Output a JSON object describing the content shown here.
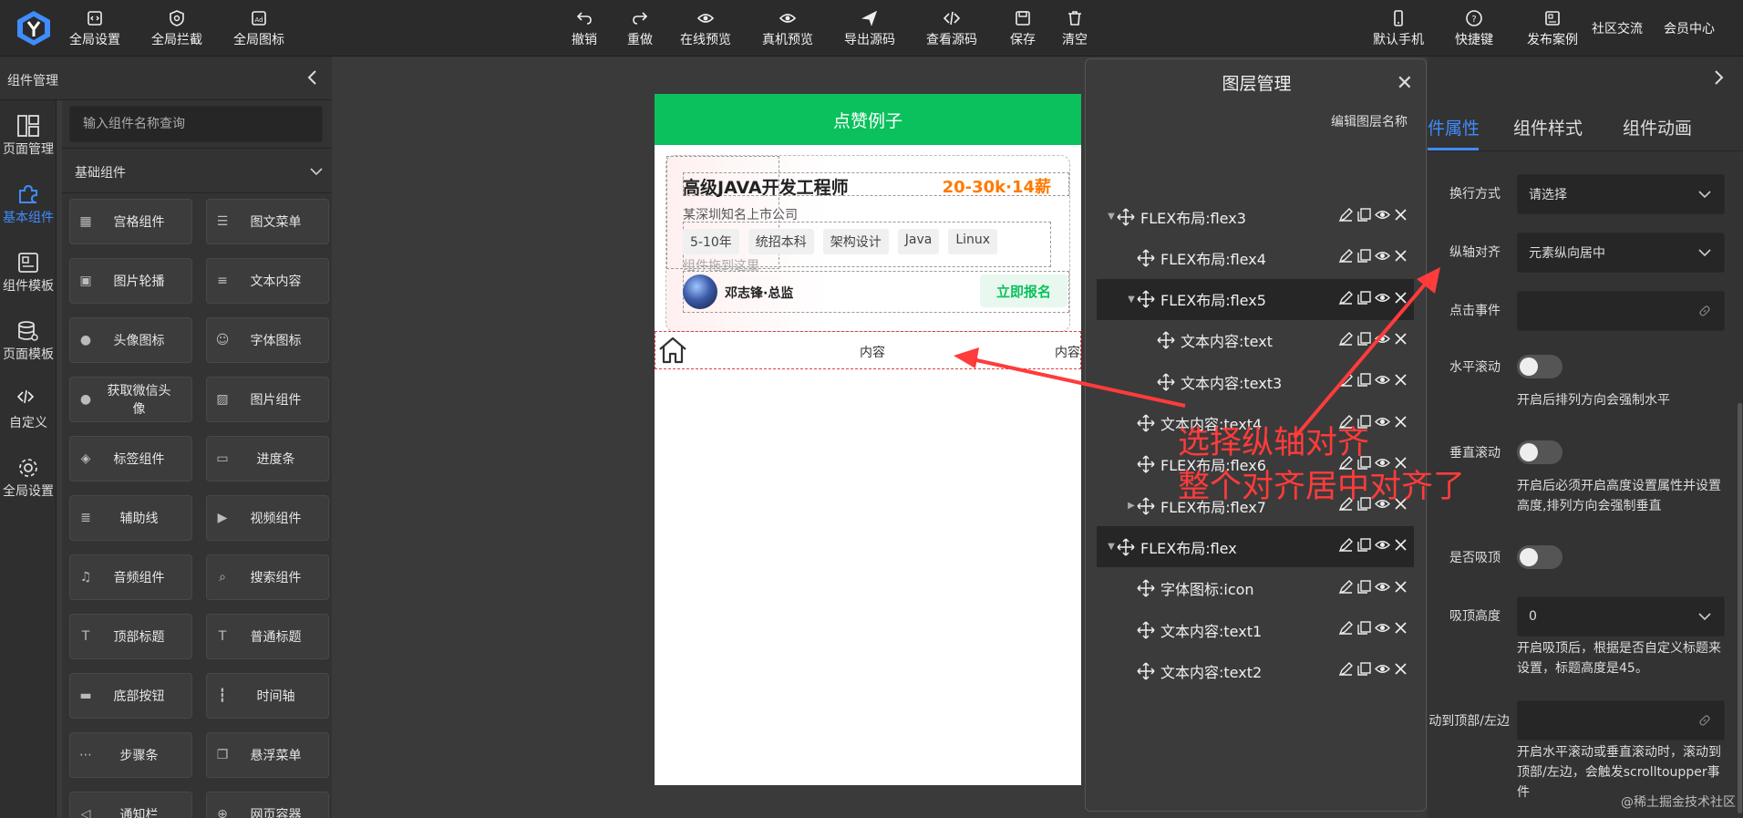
{
  "toolbar": {
    "left": [
      {
        "label": "全局设置",
        "icon": "code-file-icon"
      },
      {
        "label": "全局拦截",
        "icon": "shield-icon"
      },
      {
        "label": "全局图标",
        "icon": "image-icon"
      }
    ],
    "center": [
      {
        "label": "撤销",
        "icon": "undo-icon"
      },
      {
        "label": "重做",
        "icon": "redo-icon"
      },
      {
        "label": "在线预览",
        "icon": "eye-icon"
      },
      {
        "label": "真机预览",
        "icon": "eye-icon"
      },
      {
        "label": "导出源码",
        "icon": "send-icon"
      },
      {
        "label": "查看源码",
        "icon": "code-icon"
      },
      {
        "label": "保存",
        "icon": "save-icon"
      },
      {
        "label": "清空",
        "icon": "trash-icon"
      }
    ],
    "right": [
      {
        "label": "默认手机",
        "icon": "phone-icon"
      },
      {
        "label": "快捷键",
        "icon": "help-icon"
      },
      {
        "label": "发布案例",
        "icon": "gallery-icon"
      },
      {
        "label": "社区交流"
      },
      {
        "label": "会员中心"
      }
    ]
  },
  "rail": {
    "header": "组件管理",
    "items": [
      {
        "label": "页面管理",
        "icon": "layout-icon",
        "active": false
      },
      {
        "label": "基本组件",
        "icon": "puzzle-icon",
        "active": true
      },
      {
        "label": "组件模板",
        "icon": "template-icon",
        "active": false
      },
      {
        "label": "页面模板",
        "icon": "database-icon",
        "active": false
      },
      {
        "label": "自定义",
        "icon": "code-icon",
        "active": false
      },
      {
        "label": "全局设置",
        "icon": "gear-icon",
        "active": false
      }
    ]
  },
  "panel": {
    "search_placeholder": "输入组件名称查询",
    "category": "基础组件",
    "components": [
      {
        "label": "宫格组件",
        "icon": "grid-icon"
      },
      {
        "label": "图文菜单",
        "icon": "list-icon"
      },
      {
        "label": "图片轮播",
        "icon": "carousel-icon"
      },
      {
        "label": "文本内容",
        "icon": "text-icon"
      },
      {
        "label": "头像图标",
        "icon": "avatar-icon"
      },
      {
        "label": "字体图标",
        "icon": "smile-icon"
      },
      {
        "label": "获取微信头像",
        "icon": "avatar-icon"
      },
      {
        "label": "图片组件",
        "icon": "picture-icon"
      },
      {
        "label": "标签组件",
        "icon": "tag-icon"
      },
      {
        "label": "进度条",
        "icon": "progress-icon"
      },
      {
        "label": "辅助线",
        "icon": "lines-icon"
      },
      {
        "label": "视频组件",
        "icon": "video-icon"
      },
      {
        "label": "音频组件",
        "icon": "music-icon"
      },
      {
        "label": "搜索组件",
        "icon": "search-icon"
      },
      {
        "label": "顶部标题",
        "icon": "title-icon"
      },
      {
        "label": "普通标题",
        "icon": "title-icon"
      },
      {
        "label": "底部按钮",
        "icon": "bottom-button-icon"
      },
      {
        "label": "时间轴",
        "icon": "timeline-icon"
      },
      {
        "label": "步骤条",
        "icon": "steps-icon"
      },
      {
        "label": "悬浮菜单",
        "icon": "float-menu-icon"
      },
      {
        "label": "通知栏",
        "icon": "speaker-icon"
      },
      {
        "label": "网页容器",
        "icon": "globe-icon"
      }
    ]
  },
  "phone": {
    "header": "点赞例子",
    "job_title": "高级JAVA开发工程师",
    "salary": "20-30k·14薪",
    "company": "某深圳知名上市公司",
    "tags": [
      "5-10年",
      "统招本科",
      "架构设计",
      "Java",
      "Linux"
    ],
    "drag_hint": "组件拖到这里",
    "author": "邓志锋·总监",
    "apply": "立即报名",
    "bottom_label_1": "内容",
    "bottom_label_2": "内容"
  },
  "layers": {
    "title": "图层管理",
    "edit_label": "编辑图层名称",
    "rows": [
      {
        "label": "FLEX布局:flex3",
        "indent": 0,
        "arrow": "down",
        "selected": false
      },
      {
        "label": "FLEX布局:flex4",
        "indent": 1,
        "arrow": "",
        "selected": false
      },
      {
        "label": "FLEX布局:flex5",
        "indent": 1,
        "arrow": "down",
        "selected": true
      },
      {
        "label": "文本内容:text",
        "indent": 2,
        "arrow": "",
        "selected": false
      },
      {
        "label": "文本内容:text3",
        "indent": 2,
        "arrow": "",
        "selected": false
      },
      {
        "label": "文本内容:text4",
        "indent": 1,
        "arrow": "",
        "selected": false
      },
      {
        "label": "FLEX布局:flex6",
        "indent": 1,
        "arrow": "",
        "selected": false
      },
      {
        "label": "FLEX布局:flex7",
        "indent": 1,
        "arrow": "right",
        "selected": false
      },
      {
        "label": "FLEX布局:flex",
        "indent": 0,
        "arrow": "down",
        "selected": true
      },
      {
        "label": "字体图标:icon",
        "indent": 1,
        "arrow": "",
        "selected": false
      },
      {
        "label": "文本内容:text1",
        "indent": 1,
        "arrow": "",
        "selected": false
      },
      {
        "label": "文本内容:text2",
        "indent": 1,
        "arrow": "",
        "selected": false
      }
    ]
  },
  "props": {
    "tabs": [
      "件属性",
      "组件样式",
      "组件动画"
    ],
    "wrap_label": "换行方式",
    "wrap_value": "请选择",
    "cross_align_label": "纵轴对齐",
    "cross_align_value": "元素纵向居中",
    "click_label": "点击事件",
    "hscroll_label": "水平滚动",
    "hscroll_help": "开启后排列方向会强制水平",
    "vscroll_label": "垂直滚动",
    "vscroll_help": "开启后必须开启高度设置属性并设置高度,排列方向会强制垂直",
    "sticky_label": "是否吸顶",
    "sticky_height_label": "吸顶高度",
    "sticky_height_value": "0",
    "sticky_help": "开启吸顶后，根据是否自定义标题来设置，标题高度是45。",
    "scroll_edge_label": "动到顶部/左边",
    "scroll_edge_help": "开启水平滚动或垂直滚动时，滚动到顶部/左边，会触发scrolltoupper事件"
  },
  "annotation": {
    "line1": "选择纵轴对齐",
    "line2": "整个对齐居中对齐了"
  },
  "watermark": "@稀土掘金技术社区",
  "colors": {
    "accent": "#3f8cff",
    "green": "#0bc15d",
    "annotation": "#ff3b3b",
    "salary": "#ff7a00"
  }
}
